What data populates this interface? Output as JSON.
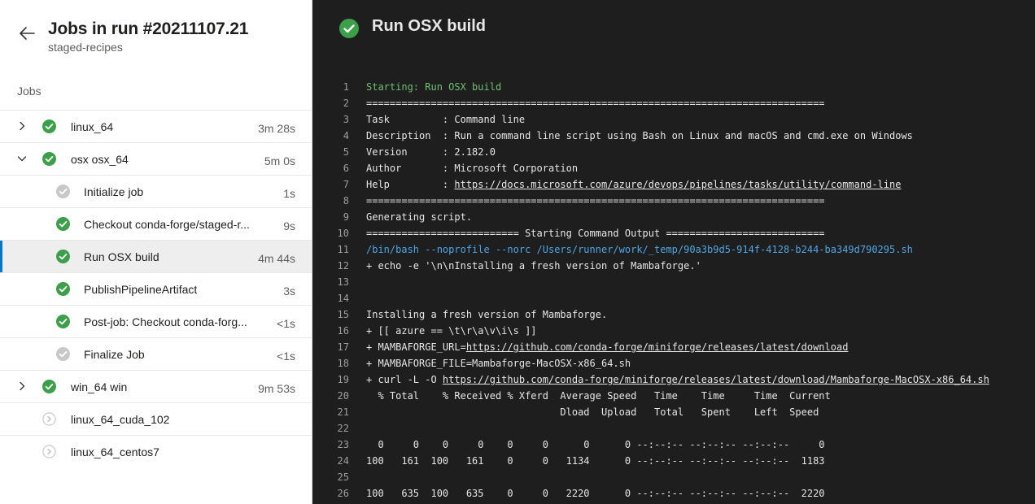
{
  "header": {
    "title": "Jobs in run #20211107.21",
    "subtitle": "staged-recipes"
  },
  "section_label": "Jobs",
  "colors": {
    "success": "#3c9f49",
    "skipped": "#c8c8c8",
    "accent": "#0078d4"
  },
  "jobs": [
    {
      "name": "linux_64",
      "duration": "3m 28s",
      "level": 0,
      "status": "success",
      "expand": "right"
    },
    {
      "name": "osx osx_64",
      "duration": "5m 0s",
      "level": 0,
      "status": "success",
      "expand": "down"
    },
    {
      "name": "Initialize job",
      "duration": "1s",
      "level": 1,
      "status": "skipped-check"
    },
    {
      "name": "Checkout conda-forge/staged-r...",
      "duration": "9s",
      "level": 1,
      "status": "success"
    },
    {
      "name": "Run OSX build",
      "duration": "4m 44s",
      "level": 1,
      "status": "success",
      "selected": true
    },
    {
      "name": "PublishPipelineArtifact",
      "duration": "3s",
      "level": 1,
      "status": "success"
    },
    {
      "name": "Post-job: Checkout conda-forg...",
      "duration": "<1s",
      "level": 1,
      "status": "success"
    },
    {
      "name": "Finalize Job",
      "duration": "<1s",
      "level": 1,
      "status": "skipped-check"
    },
    {
      "name": "win_64 win",
      "duration": "9m 53s",
      "level": 0,
      "status": "success",
      "expand": "right"
    },
    {
      "name": "linux_64_cuda_102",
      "duration": "",
      "level": 0,
      "status": "pending"
    },
    {
      "name": "linux_64_centos7",
      "duration": "",
      "level": 0,
      "status": "pending"
    }
  ],
  "step": {
    "title": "Run OSX build"
  },
  "log": [
    {
      "n": "1",
      "style": "green",
      "parts": [
        {
          "t": "Starting: Run OSX build"
        }
      ]
    },
    {
      "n": "2",
      "parts": [
        {
          "t": "=============================================================================="
        }
      ]
    },
    {
      "n": "3",
      "parts": [
        {
          "t": "Task         : Command line"
        }
      ]
    },
    {
      "n": "4",
      "parts": [
        {
          "t": "Description  : Run a command line script using Bash on Linux and macOS and cmd.exe on Windows"
        }
      ]
    },
    {
      "n": "5",
      "parts": [
        {
          "t": "Version      : 2.182.0"
        }
      ]
    },
    {
      "n": "6",
      "parts": [
        {
          "t": "Author       : Microsoft Corporation"
        }
      ]
    },
    {
      "n": "7",
      "parts": [
        {
          "t": "Help         : "
        },
        {
          "t": "https://docs.microsoft.com/azure/devops/pipelines/tasks/utility/command-line",
          "u": true
        }
      ]
    },
    {
      "n": "8",
      "parts": [
        {
          "t": "=============================================================================="
        }
      ]
    },
    {
      "n": "9",
      "parts": [
        {
          "t": "Generating script."
        }
      ]
    },
    {
      "n": "10",
      "parts": [
        {
          "t": "========================== Starting Command Output ==========================="
        }
      ]
    },
    {
      "n": "11",
      "style": "blue",
      "parts": [
        {
          "t": "/bin/bash --noprofile --norc /Users/runner/work/_temp/90a3b9d5-914f-4128-b244-ba349d790295.sh"
        }
      ]
    },
    {
      "n": "12",
      "parts": [
        {
          "t": "+ echo -e '\\n\\nInstalling a fresh version of Mambaforge.'"
        }
      ]
    },
    {
      "n": "13",
      "parts": [
        {
          "t": ""
        }
      ]
    },
    {
      "n": "14",
      "parts": [
        {
          "t": ""
        }
      ]
    },
    {
      "n": "15",
      "parts": [
        {
          "t": "Installing a fresh version of Mambaforge."
        }
      ]
    },
    {
      "n": "16",
      "parts": [
        {
          "t": "+ [[ azure == \\t\\r\\a\\v\\i\\s ]]"
        }
      ]
    },
    {
      "n": "17",
      "parts": [
        {
          "t": "+ MAMBAFORGE_URL="
        },
        {
          "t": "https://github.com/conda-forge/miniforge/releases/latest/download",
          "u": true
        }
      ]
    },
    {
      "n": "18",
      "parts": [
        {
          "t": "+ MAMBAFORGE_FILE=Mambaforge-MacOSX-x86_64.sh"
        }
      ]
    },
    {
      "n": "19",
      "parts": [
        {
          "t": "+ curl -L -O "
        },
        {
          "t": "https://github.com/conda-forge/miniforge/releases/latest/download/Mambaforge-MacOSX-x86_64.sh",
          "u": true
        }
      ]
    },
    {
      "n": "20",
      "parts": [
        {
          "t": "  % Total    % Received % Xferd  Average Speed   Time    Time     Time  Current"
        }
      ]
    },
    {
      "n": "21",
      "parts": [
        {
          "t": "                                 Dload  Upload   Total   Spent    Left  Speed"
        }
      ]
    },
    {
      "n": "22",
      "parts": [
        {
          "t": ""
        }
      ]
    },
    {
      "n": "23",
      "parts": [
        {
          "t": "  0     0    0     0    0     0      0      0 --:--:-- --:--:-- --:--:--     0"
        }
      ]
    },
    {
      "n": "24",
      "parts": [
        {
          "t": "100   161  100   161    0     0   1134      0 --:--:-- --:--:-- --:--:--  1183"
        }
      ]
    },
    {
      "n": "25",
      "parts": [
        {
          "t": ""
        }
      ]
    },
    {
      "n": "26",
      "parts": [
        {
          "t": "100   635  100   635    0     0   2220      0 --:--:-- --:--:-- --:--:--  2220"
        }
      ]
    }
  ]
}
